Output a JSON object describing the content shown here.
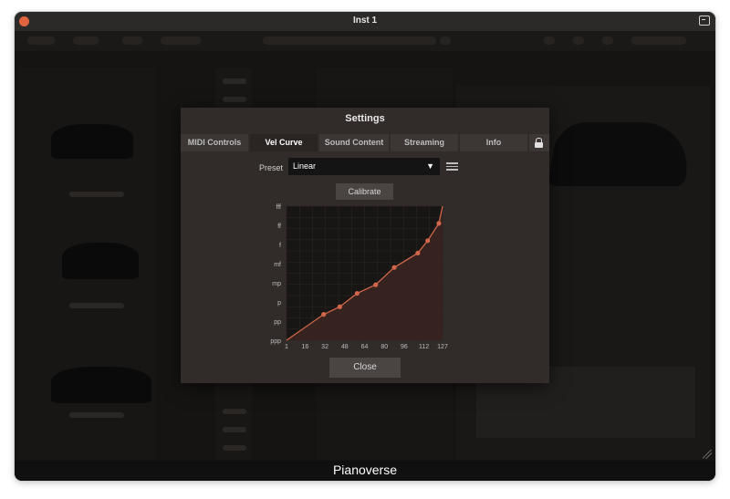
{
  "window": {
    "title": "Inst 1"
  },
  "app": {
    "brand": "Pianoverse"
  },
  "dialog": {
    "title": "Settings",
    "tabs": [
      {
        "label": "MIDI Controls"
      },
      {
        "label": "Vel Curve",
        "active": true
      },
      {
        "label": "Sound Content"
      },
      {
        "label": "Streaming"
      },
      {
        "label": "Info"
      }
    ],
    "preset": {
      "label": "Preset",
      "value": "Linear"
    },
    "calibrate_label": "Calibrate",
    "close_label": "Close"
  },
  "colors": {
    "curve": "#d0664a",
    "fill": "#3a2320",
    "background": "#1c1a19"
  },
  "chart_data": {
    "type": "line",
    "x_ticks": [
      "1",
      "16",
      "32",
      "48",
      "64",
      "80",
      "96",
      "112",
      "127"
    ],
    "y_ticks": [
      "ppp",
      "pp",
      "p",
      "mp",
      "mf",
      "f",
      "ff",
      "fff"
    ],
    "xlim": [
      1,
      127
    ],
    "ylim": [
      0,
      7
    ],
    "grid": true,
    "points": [
      {
        "x": 1,
        "y": 0
      },
      {
        "x": 31,
        "y": 1.35
      },
      {
        "x": 44,
        "y": 1.75
      },
      {
        "x": 58,
        "y": 2.45
      },
      {
        "x": 73,
        "y": 2.9
      },
      {
        "x": 88,
        "y": 3.8
      },
      {
        "x": 107,
        "y": 4.55
      },
      {
        "x": 115,
        "y": 5.2
      },
      {
        "x": 124,
        "y": 6.1
      }
    ],
    "curve_end": {
      "x": 127,
      "y": 7
    }
  }
}
